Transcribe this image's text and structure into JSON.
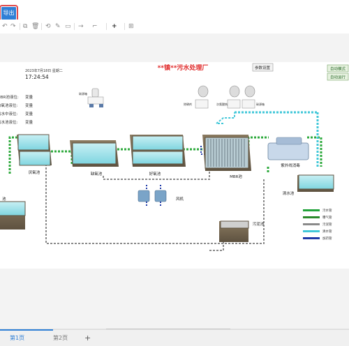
{
  "toolbar": {
    "export_label": "导出",
    "tools": [
      "↶",
      "↷",
      "⧉",
      "🗑",
      "⟲",
      "✎",
      "▭",
      "→",
      "⌐",
      "+",
      "⊞"
    ]
  },
  "diagram": {
    "title": "**镇**污水处理厂",
    "date": "2023年7月18日 星期二",
    "time": "17:24:54",
    "param_button": "参数设置",
    "mode_button": "自动模式",
    "run_button": "自动运行",
    "levels": [
      {
        "label": "MBR池液位:",
        "value": "变量"
      },
      {
        "label": "缺氧池液位:",
        "value": "变量"
      },
      {
        "label": "出水中液位:",
        "value": "变量"
      },
      {
        "label": "出水池液位:",
        "value": "变量"
      }
    ],
    "tanks": {
      "anoxic": "厌氧池",
      "anoxic2": "缺氧池",
      "aerobic": "好氧池",
      "mbr": "MBR池",
      "uv": "紫外线消毒",
      "clear": "清水池",
      "sludge": "污泥池",
      "fan": "风机",
      "inlet": "池"
    },
    "chemicals": {
      "c1": "碳源箱",
      "c2": "除磷剂",
      "c3": "次氯酸钠",
      "c4": "碳源箱"
    },
    "legend": [
      {
        "label": "污水管",
        "color": "#22a33a"
      },
      {
        "label": "曝气管",
        "color": "#2b8a2b"
      },
      {
        "label": "污泥管",
        "color": "#8a8a8a"
      },
      {
        "label": "清水管",
        "color": "#41c7d8"
      },
      {
        "label": "加药管",
        "color": "#1f3aa8"
      }
    ]
  },
  "pages": {
    "page1": "第1页",
    "page2": "第2页",
    "add": "+"
  }
}
